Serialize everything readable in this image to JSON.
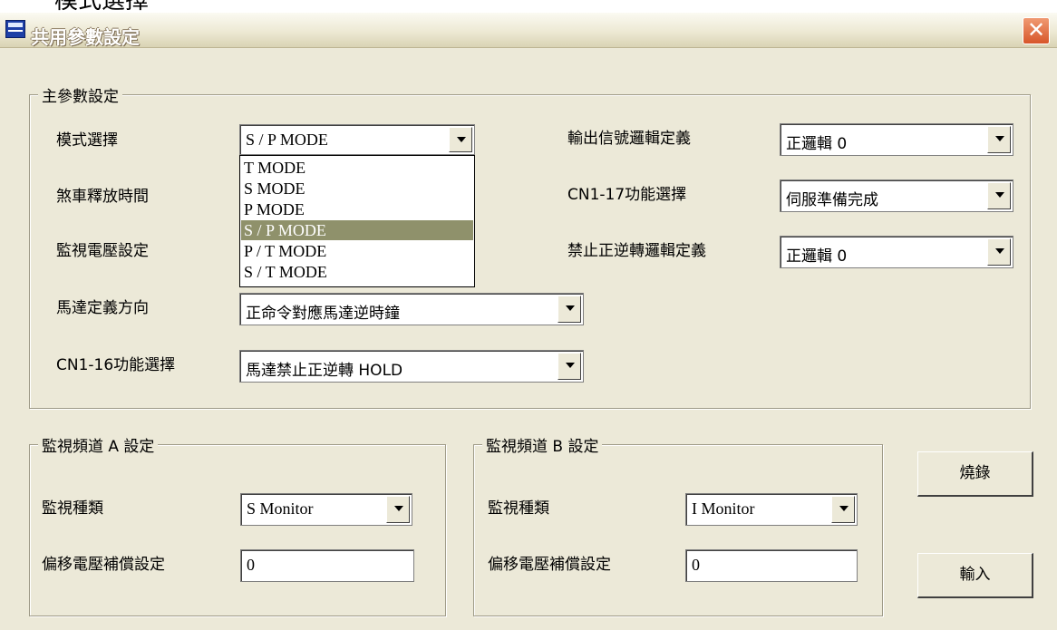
{
  "caption": "模式選擇",
  "window": {
    "title": "共用參數設定",
    "close_glyph": "✕"
  },
  "main_group": {
    "legend": "主參數設定",
    "mode_select": {
      "label": "模式選擇",
      "value": "S / P MODE",
      "options": [
        "T MODE",
        "S MODE",
        "P MODE",
        "S / P MODE",
        "P / T MODE",
        "S / T MODE"
      ],
      "selected_index": 3
    },
    "brake_release": {
      "label": "煞車釋放時間"
    },
    "monitor_voltage": {
      "label": "監視電壓設定"
    },
    "motor_direction": {
      "label": "馬達定義方向",
      "value": "正命令對應馬達逆時鐘"
    },
    "cn1_16": {
      "label": "CN1-16功能選擇",
      "value": "馬達禁止正逆轉 HOLD"
    },
    "output_logic": {
      "label": "輸出信號邏輯定義",
      "value": "正邏輯 0"
    },
    "cn1_17": {
      "label": "CN1-17功能選擇",
      "value": "伺服準備完成"
    },
    "prohibit_logic": {
      "label": "禁止正逆轉邏輯定義",
      "value": "正邏輯 0"
    }
  },
  "channel_a": {
    "legend": "監視頻道 A 設定",
    "type_label": "監視種類",
    "type_value": "S Monitor",
    "offset_label": "偏移電壓補償設定",
    "offset_value": "0"
  },
  "channel_b": {
    "legend": "監視頻道 B 設定",
    "type_label": "監視種類",
    "type_value": "I Monitor",
    "offset_label": "偏移電壓補償設定",
    "offset_value": "0"
  },
  "buttons": {
    "burn": "燒錄",
    "import": "輸入"
  },
  "colors": {
    "selection": "#8f916b",
    "dialog_bg": "#ece9d8",
    "close_button": "#d7562a"
  }
}
